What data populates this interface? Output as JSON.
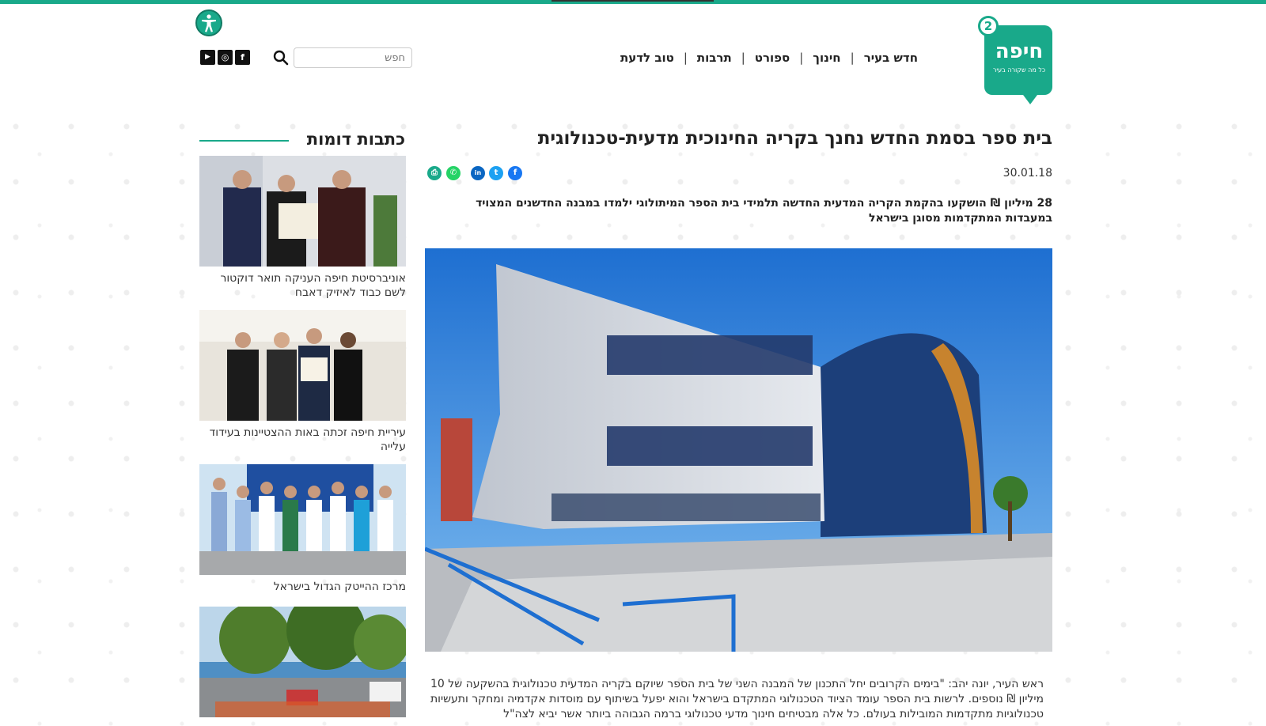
{
  "site": {
    "logo_text": "חיפה",
    "logo_number": "2",
    "logo_tagline": "כל מה שקורה בעיר"
  },
  "nav": {
    "items": [
      "חדש בעיר",
      "חינוך",
      "ספורט",
      "תרבות",
      "טוב לדעת"
    ]
  },
  "search": {
    "placeholder": "חפש"
  },
  "social": {
    "facebook": "f",
    "instagram": "◎",
    "youtube": "▶"
  },
  "article": {
    "title": "בית ספר בסמת החדש נחנך בקריה החינוכית מדעית-טכנולוגית",
    "date": "30.01.18",
    "lead": "28 מיליון ₪ הושקעו בהקמת הקריה המדעית החדשה תלמידי בית הספר המיתולוגי ילמדו במבנה החדשנים המצויד במעבדות המתקדמות מסוגן בישראל",
    "body": "ראש העיר, יונה יהב: \"בימים הקרובים יחל התכנון של המבנה השני של בית הספר שיוקם בקריה המדעית טכנולוגית בהשקעה של 10 מיליון ₪ נוספים. לרשות בית הספר עומד הציוד הטכנולוגי המתקדם בישראל והוא יפעל בשיתוף עם מוסדות אקדמיה ומחקר ותעשיות טכנולוגיות מתקדמות המובילות בעולם. כל אלה מבטיחים חינוך מדעי טכנולוגי ברמה הגבוהה ביותר אשר יביא לצה\"ל"
  },
  "sidebar": {
    "title": "כתבות דומות",
    "cards": [
      {
        "caption": "אוניברסיטת חיפה העניקה תואר דוקטור לשם כבוד לאיזיק דאבח"
      },
      {
        "caption": "עיריית חיפה זכתה באות ההצטיינות בעידוד עלייה"
      },
      {
        "caption": "מרכז ההייטק הגדול בישראל"
      },
      {
        "caption": ""
      }
    ]
  },
  "colors": {
    "brand": "#19a98a"
  }
}
